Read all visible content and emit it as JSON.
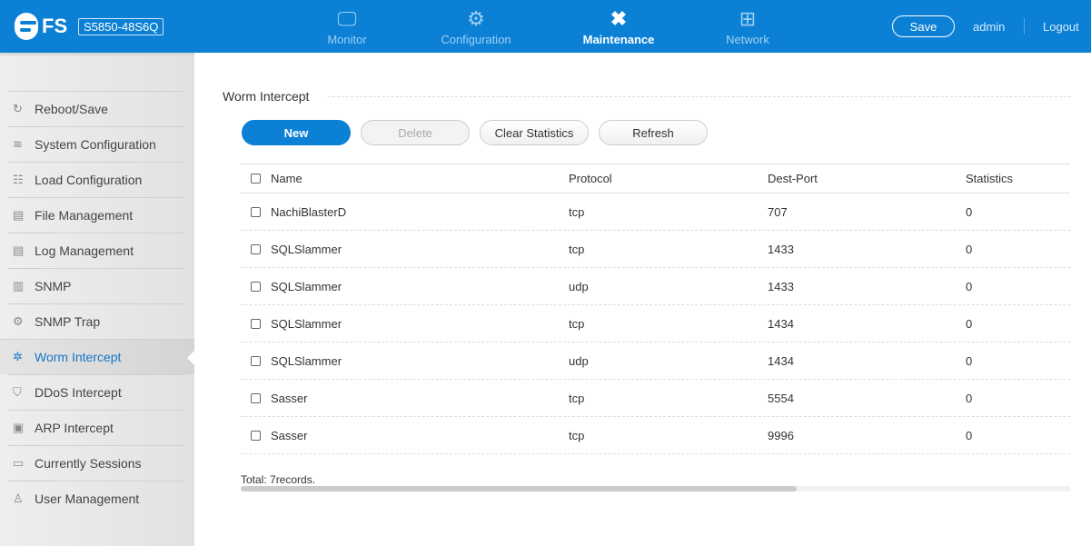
{
  "header": {
    "logo": "FS",
    "model": "S5850-48S6Q",
    "nav": [
      {
        "label": "Monitor",
        "icon": "monitor-icon"
      },
      {
        "label": "Configuration",
        "icon": "gear-icon"
      },
      {
        "label": "Maintenance",
        "icon": "tools-icon"
      },
      {
        "label": "Network",
        "icon": "network-icon"
      }
    ],
    "save": "Save",
    "user": "admin",
    "logout": "Logout"
  },
  "sidebar": {
    "items": [
      {
        "label": "Reboot/Save",
        "icon": "↻"
      },
      {
        "label": "System Configuration",
        "icon": "≋"
      },
      {
        "label": "Load Configuration",
        "icon": "☷"
      },
      {
        "label": "File Management",
        "icon": "▤"
      },
      {
        "label": "Log Management",
        "icon": "▤"
      },
      {
        "label": "SNMP",
        "icon": "▥"
      },
      {
        "label": "SNMP Trap",
        "icon": "⚙"
      },
      {
        "label": "Worm Intercept",
        "icon": "✲"
      },
      {
        "label": "DDoS Intercept",
        "icon": "⛉"
      },
      {
        "label": "ARP Intercept",
        "icon": "▣"
      },
      {
        "label": "Currently Sessions",
        "icon": "▭"
      },
      {
        "label": "User Management",
        "icon": "♙"
      }
    ]
  },
  "main": {
    "title": "Worm Intercept",
    "buttons": {
      "new": "New",
      "delete": "Delete",
      "clear": "Clear Statistics",
      "refresh": "Refresh"
    },
    "columns": [
      "Name",
      "Protocol",
      "Dest-Port",
      "Statistics"
    ],
    "rows": [
      [
        "NachiBlasterD",
        "tcp",
        "707",
        "0"
      ],
      [
        "SQLSlammer",
        "tcp",
        "1433",
        "0"
      ],
      [
        "SQLSlammer",
        "udp",
        "1433",
        "0"
      ],
      [
        "SQLSlammer",
        "tcp",
        "1434",
        "0"
      ],
      [
        "SQLSlammer",
        "udp",
        "1434",
        "0"
      ],
      [
        "Sasser",
        "tcp",
        "5554",
        "0"
      ],
      [
        "Sasser",
        "tcp",
        "9996",
        "0"
      ]
    ],
    "total": "Total: 7records."
  }
}
